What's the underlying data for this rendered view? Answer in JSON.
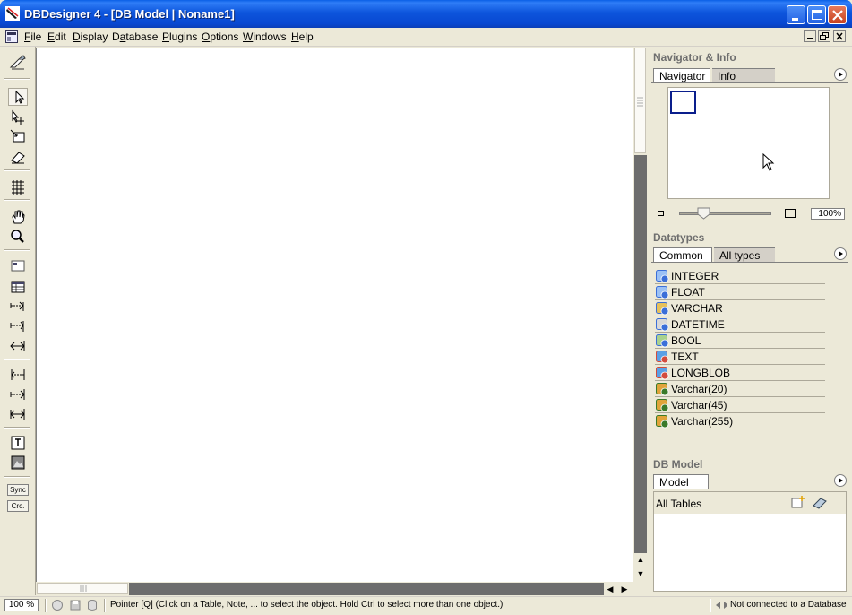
{
  "window": {
    "title": "DBDesigner 4 - [DB Model | Noname1]",
    "controls": [
      "minimize-icon",
      "maximize-icon",
      "close-icon"
    ]
  },
  "menu": [
    {
      "label": "File",
      "accel": "F"
    },
    {
      "label": "Edit",
      "accel": "E"
    },
    {
      "label": "Display",
      "accel": "D"
    },
    {
      "label": "Database",
      "accel": "a"
    },
    {
      "label": "Plugins",
      "accel": "P"
    },
    {
      "label": "Options",
      "accel": "O"
    },
    {
      "label": "Windows",
      "accel": "W"
    },
    {
      "label": "Help",
      "accel": "H"
    }
  ],
  "toolbar": {
    "tools": [
      "work-mode-icon",
      "pointer-icon",
      "move-icon",
      "scale-icon",
      "eraser-icon",
      "grid-icon",
      "hand-icon",
      "zoom-icon",
      "region-icon",
      "table-icon",
      "relation-1n-icon",
      "relation-1n-sub-icon",
      "relation-nm-icon",
      "relation-11-icon",
      "relation-11-sub-icon",
      "relation-11-nonid-icon",
      "note-icon",
      "image-icon"
    ],
    "sync_label": "Sync",
    "crc_label": "Crc."
  },
  "navigator": {
    "panel_title": "Navigator & Info",
    "tabs": [
      "Navigator",
      "Info"
    ],
    "active_tab": "Navigator",
    "zoom_value": "100%",
    "zoom_level": 0.2
  },
  "datatypes": {
    "panel_title": "Datatypes",
    "tabs": [
      "Common",
      "All types"
    ],
    "active_tab": "Common",
    "items": [
      {
        "label": "INTEGER",
        "icon": "numeric-type-icon"
      },
      {
        "label": "FLOAT",
        "icon": "numeric-type-icon"
      },
      {
        "label": "VARCHAR",
        "icon": "string-type-icon"
      },
      {
        "label": "DATETIME",
        "icon": "datetime-type-icon"
      },
      {
        "label": "BOOL",
        "icon": "bool-type-icon"
      },
      {
        "label": "TEXT",
        "icon": "blob-type-icon"
      },
      {
        "label": "LONGBLOB",
        "icon": "blob-type-icon"
      },
      {
        "label": "Varchar(20)",
        "icon": "user-type-icon"
      },
      {
        "label": "Varchar(45)",
        "icon": "user-type-icon"
      },
      {
        "label": "Varchar(255)",
        "icon": "user-type-icon"
      }
    ]
  },
  "db_model": {
    "panel_title": "DB Model",
    "tabs": [
      "Model"
    ],
    "tree_root": "All Tables"
  },
  "statusbar": {
    "zoom": "100 %",
    "message": "Pointer [Q] (Click on a Table, Note, ... to select the object. Hold Ctrl to select more than one object.)",
    "connection": "Not connected to a Database"
  },
  "colors": {
    "titlebar": "#0a5fe6",
    "panel_bg": "#ece9d8",
    "canvas": "#ffffff",
    "nav_viewport": "#0a1e8c"
  }
}
